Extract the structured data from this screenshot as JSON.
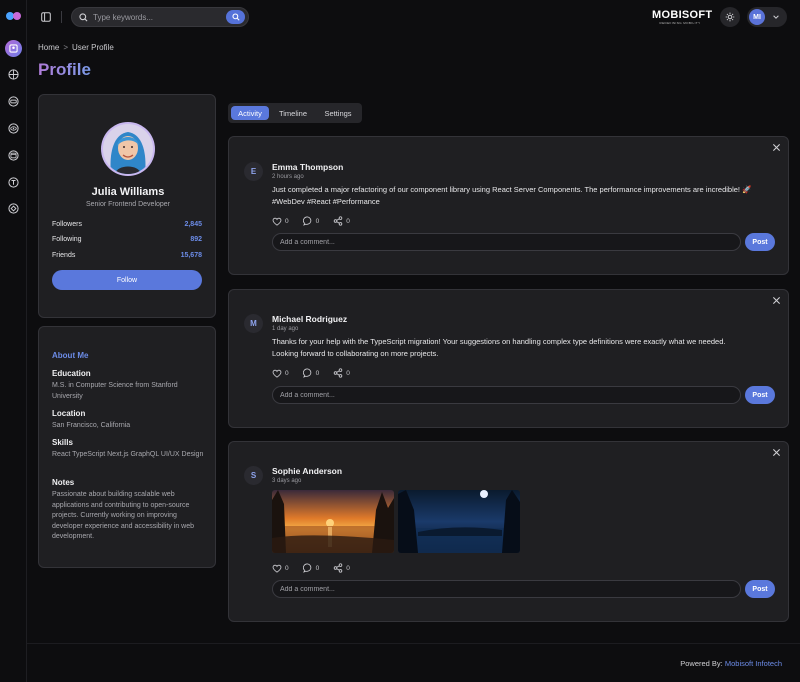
{
  "search": {
    "placeholder": "Type keywords..."
  },
  "brand": {
    "name": "MOBISOFT",
    "tagline": "REDEFINING MOBILITY"
  },
  "user": {
    "initials": "MI"
  },
  "breadcrumb": {
    "home": "Home",
    "separator": ">",
    "current": "User Profile"
  },
  "page": {
    "title": "Profile"
  },
  "profile": {
    "name": "Julia Williams",
    "role": "Senior Frontend Developer",
    "stats": [
      {
        "label": "Followers",
        "value": "2,845"
      },
      {
        "label": "Following",
        "value": "892"
      },
      {
        "label": "Friends",
        "value": "15,678"
      }
    ],
    "follow_label": "Follow"
  },
  "about": {
    "title": "About Me",
    "education_label": "Education",
    "education": "M.S. in Computer Science from Stanford University",
    "location_label": "Location",
    "location": "San Francisco, California",
    "skills_label": "Skills",
    "skills": "React TypeScript Next.js GraphQL UI/UX Design",
    "notes_label": "Notes",
    "notes": "Passionate about building scalable web applications and contributing to open-source projects. Currently working on improving developer experience and accessibility in web development."
  },
  "tabs": [
    "Activity",
    "Timeline",
    "Settings"
  ],
  "posts": [
    {
      "initial": "E",
      "author": "Emma Thompson",
      "time": "2 hours ago",
      "text": "Just completed a major refactoring of our component library using React Server Components. The performance improvements are incredible! 🚀 #WebDev #React #Performance",
      "likes": "0",
      "comments": "0",
      "shares": "0"
    },
    {
      "initial": "M",
      "author": "Michael Rodriguez",
      "time": "1 day ago",
      "text": "Thanks for your help with the TypeScript migration! Your suggestions on handling complex type definitions were exactly what we needed. Looking forward to collaborating on more projects.",
      "likes": "0",
      "comments": "0",
      "shares": "0"
    },
    {
      "initial": "S",
      "author": "Sophie Anderson",
      "time": "3 days ago",
      "text": "",
      "likes": "0",
      "comments": "0",
      "shares": "0"
    }
  ],
  "comment": {
    "placeholder": "Add a comment...",
    "post_label": "Post"
  },
  "footer": {
    "prefix": "Powered By:",
    "company": "Mobisoft Infotech"
  }
}
